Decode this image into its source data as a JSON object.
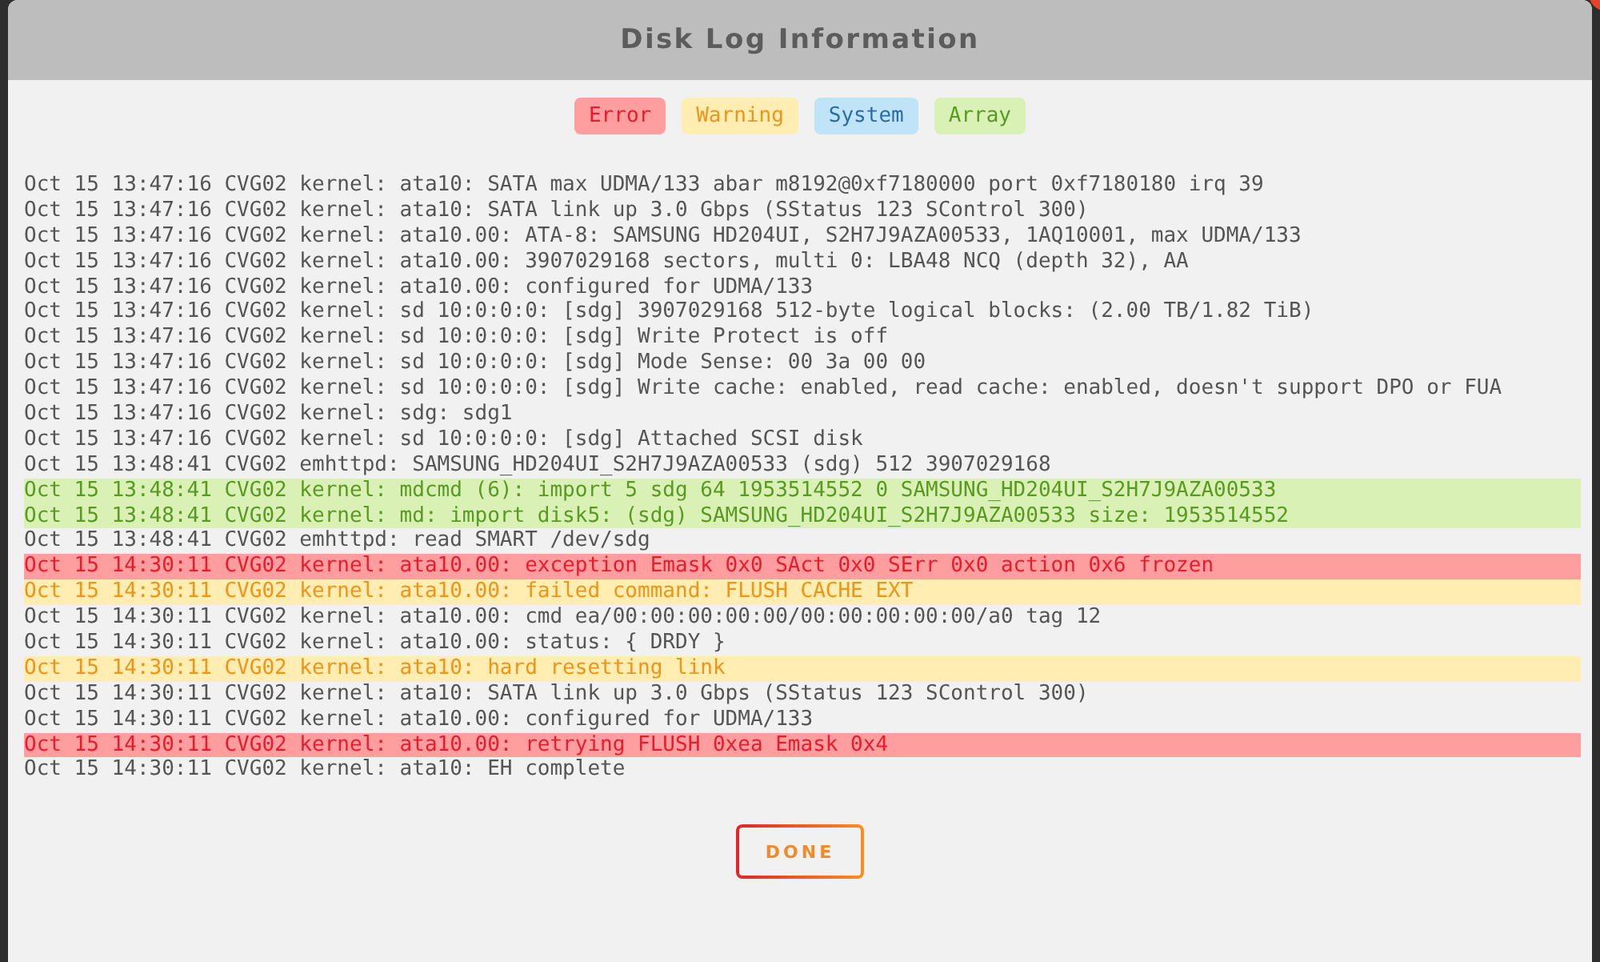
{
  "dialog": {
    "title": "Disk Log Information",
    "legend": [
      {
        "label": "Error",
        "kind": "error"
      },
      {
        "label": "Warning",
        "kind": "warning"
      },
      {
        "label": "System",
        "kind": "system"
      },
      {
        "label": "Array",
        "kind": "array"
      }
    ],
    "log_lines": [
      {
        "text": "Oct 15 13:47:16 CVG02 kernel: ata10: SATA max UDMA/133 abar m8192@0xf7180000 port 0xf7180180 irq 39",
        "kind": "plain"
      },
      {
        "text": "Oct 15 13:47:16 CVG02 kernel: ata10: SATA link up 3.0 Gbps (SStatus 123 SControl 300)",
        "kind": "plain"
      },
      {
        "text": "Oct 15 13:47:16 CVG02 kernel: ata10.00: ATA-8: SAMSUNG HD204UI, S2H7J9AZA00533, 1AQ10001, max UDMA/133",
        "kind": "plain"
      },
      {
        "text": "Oct 15 13:47:16 CVG02 kernel: ata10.00: 3907029168 sectors, multi 0: LBA48 NCQ (depth 32), AA",
        "kind": "plain"
      },
      {
        "text": "Oct 15 13:47:16 CVG02 kernel: ata10.00: configured for UDMA/133",
        "kind": "plain"
      },
      {
        "text": "Oct 15 13:47:16 CVG02 kernel: sd 10:0:0:0: [sdg] 3907029168 512-byte logical blocks: (2.00 TB/1.82 TiB)",
        "kind": "plain"
      },
      {
        "text": "Oct 15 13:47:16 CVG02 kernel: sd 10:0:0:0: [sdg] Write Protect is off",
        "kind": "plain"
      },
      {
        "text": "Oct 15 13:47:16 CVG02 kernel: sd 10:0:0:0: [sdg] Mode Sense: 00 3a 00 00",
        "kind": "plain"
      },
      {
        "text": "Oct 15 13:47:16 CVG02 kernel: sd 10:0:0:0: [sdg] Write cache: enabled, read cache: enabled, doesn't support DPO or FUA",
        "kind": "plain"
      },
      {
        "text": "Oct 15 13:47:16 CVG02 kernel: sdg: sdg1",
        "kind": "plain"
      },
      {
        "text": "Oct 15 13:47:16 CVG02 kernel: sd 10:0:0:0: [sdg] Attached SCSI disk",
        "kind": "plain"
      },
      {
        "text": "Oct 15 13:48:41 CVG02 emhttpd: SAMSUNG_HD204UI_S2H7J9AZA00533 (sdg) 512 3907029168",
        "kind": "plain"
      },
      {
        "text": "Oct 15 13:48:41 CVG02 kernel: mdcmd (6): import 5 sdg 64 1953514552 0 SAMSUNG_HD204UI_S2H7J9AZA00533",
        "kind": "array"
      },
      {
        "text": "Oct 15 13:48:41 CVG02 kernel: md: import disk5: (sdg) SAMSUNG_HD204UI_S2H7J9AZA00533 size: 1953514552",
        "kind": "array"
      },
      {
        "text": "Oct 15 13:48:41 CVG02 emhttpd: read SMART /dev/sdg",
        "kind": "plain"
      },
      {
        "text": "Oct 15 14:30:11 CVG02 kernel: ata10.00: exception Emask 0x0 SAct 0x0 SErr 0x0 action 0x6 frozen",
        "kind": "error"
      },
      {
        "text": "Oct 15 14:30:11 CVG02 kernel: ata10.00: failed command: FLUSH CACHE EXT",
        "kind": "warning"
      },
      {
        "text": "Oct 15 14:30:11 CVG02 kernel: ata10.00: cmd ea/00:00:00:00:00/00:00:00:00:00/a0 tag 12",
        "kind": "plain"
      },
      {
        "text": "Oct 15 14:30:11 CVG02 kernel: ata10.00: status: { DRDY }",
        "kind": "plain"
      },
      {
        "text": "Oct 15 14:30:11 CVG02 kernel: ata10: hard resetting link",
        "kind": "warning"
      },
      {
        "text": "Oct 15 14:30:11 CVG02 kernel: ata10: SATA link up 3.0 Gbps (SStatus 123 SControl 300)",
        "kind": "plain"
      },
      {
        "text": "Oct 15 14:30:11 CVG02 kernel: ata10.00: configured for UDMA/133",
        "kind": "plain"
      },
      {
        "text": "Oct 15 14:30:11 CVG02 kernel: ata10.00: retrying FLUSH 0xea Emask 0x4",
        "kind": "error"
      },
      {
        "text": "Oct 15 14:30:11 CVG02 kernel: ata10: EH complete",
        "kind": "plain"
      }
    ],
    "button": "DONE"
  }
}
